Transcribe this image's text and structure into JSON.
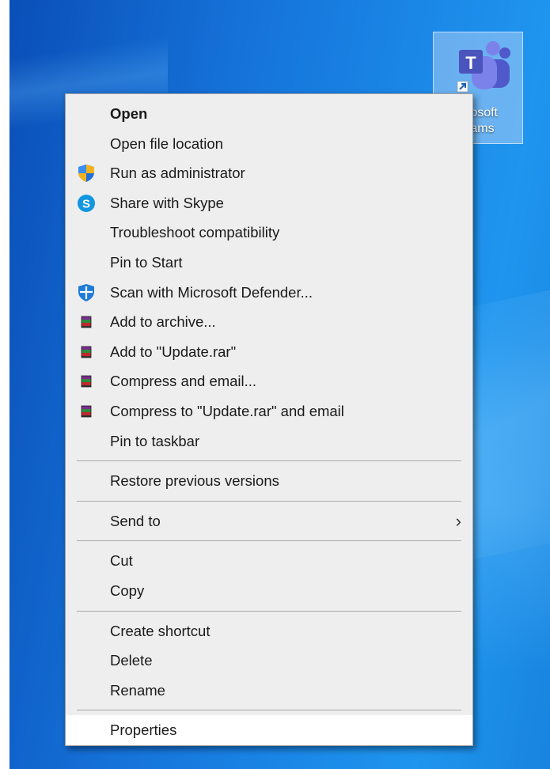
{
  "desktop": {
    "icon_label": "Microsoft Teams",
    "icon_label_visible_line1": "crosoft",
    "icon_label_visible_line2": "eams",
    "icon_name": "microsoft-teams-icon",
    "accent": "#1a78d8"
  },
  "menu": {
    "items": [
      {
        "label": "Open",
        "bold": true,
        "icon": ""
      },
      {
        "label": "Open file location",
        "icon": ""
      },
      {
        "label": "Run as administrator",
        "icon": "uac-shield-icon"
      },
      {
        "label": "Share with Skype",
        "icon": "skype-icon"
      },
      {
        "label": "Troubleshoot compatibility",
        "icon": ""
      },
      {
        "label": "Pin to Start",
        "icon": ""
      },
      {
        "label": "Scan with Microsoft Defender...",
        "icon": "defender-icon"
      },
      {
        "label": "Add to archive...",
        "icon": "winrar-icon"
      },
      {
        "label": "Add to \"Update.rar\"",
        "icon": "winrar-icon"
      },
      {
        "label": "Compress and email...",
        "icon": "winrar-icon"
      },
      {
        "label": "Compress to \"Update.rar\" and email",
        "icon": "winrar-icon"
      },
      {
        "label": "Pin to taskbar",
        "icon": ""
      },
      {
        "label": "Restore previous versions",
        "icon": ""
      },
      {
        "label": "Send to",
        "icon": "",
        "submenu_arrow": "›"
      },
      {
        "label": "Cut",
        "icon": ""
      },
      {
        "label": "Copy",
        "icon": ""
      },
      {
        "label": "Create shortcut",
        "icon": ""
      },
      {
        "label": "Delete",
        "icon": ""
      },
      {
        "label": "Rename",
        "icon": ""
      },
      {
        "label": "Properties",
        "icon": "",
        "highlighted": true
      }
    ]
  }
}
